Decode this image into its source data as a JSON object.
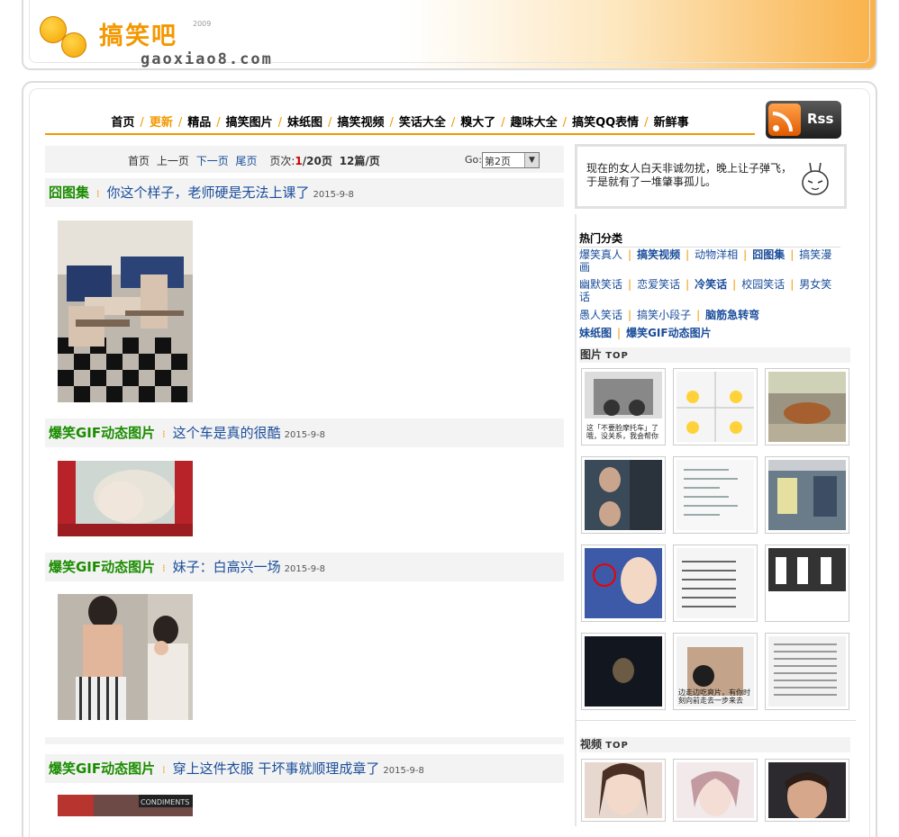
{
  "logo": {
    "cn": "搞笑吧",
    "year": "2009",
    "en": "gaoxiao8.com"
  },
  "nav": [
    {
      "label": "首页",
      "active": false
    },
    {
      "label": "更新",
      "active": true
    },
    {
      "label": "精品",
      "active": false
    },
    {
      "label": "搞笑图片",
      "active": false
    },
    {
      "label": "妹纸图",
      "active": false
    },
    {
      "label": "搞笑视频",
      "active": false
    },
    {
      "label": "笑话大全",
      "active": false
    },
    {
      "label": "糗大了",
      "active": false
    },
    {
      "label": "趣味大全",
      "active": false
    },
    {
      "label": "搞笑QQ表情",
      "active": false
    },
    {
      "label": "新鲜事",
      "active": false
    }
  ],
  "rss": {
    "label": "Rss"
  },
  "pager": {
    "first": "首页",
    "prev": "上一页",
    "next": "下一页",
    "last": "尾页",
    "pages_label": "页次:",
    "current": "1",
    "total": "/20页",
    "per_page": "12篇/页",
    "go_label": "Go:",
    "go_value": "第2页"
  },
  "posts": [
    {
      "category": "囧图集",
      "title": "你这个样子，老师硬是无法上课了",
      "date": "2015-9-8"
    },
    {
      "category": "爆笑GIF动态图片",
      "title": "这个车是真的很酷",
      "date": "2015-9-8"
    },
    {
      "category": "爆笑GIF动态图片",
      "title": "妹子：白高兴一场",
      "date": "2015-9-8"
    },
    {
      "category": "爆笑GIF动态图片",
      "title": "穿上这件衣服 干坏事就顺理成章了",
      "date": "2015-9-8"
    }
  ],
  "sidebar": {
    "quote": "现在的女人白天非诚勿扰，晚上让子弹飞，于是就有了一堆肇事孤儿。",
    "hot_title": "热门分类",
    "hot_rows": [
      [
        "爆笑真人",
        "搞笑视频",
        "动物洋相",
        "囧图集",
        "搞笑漫画"
      ],
      [
        "幽默笑话",
        "恋爱笑话",
        "冷笑话",
        "校园笑话",
        "男女笑话"
      ],
      [
        "愚人笑话",
        "搞笑小段子",
        "脑筋急转弯"
      ],
      [
        "妹纸图",
        "爆笑GIF动态图片"
      ]
    ],
    "pics_title": "图片",
    "pics_top": "TOP",
    "video_title": "视频",
    "video_top": "TOP",
    "pic_captions": [
      "这「不要脸摩托车」了 哦，没关系，我会帮你脸哈",
      "",
      "",
      "",
      "",
      "",
      "",
      "",
      "",
      "",
      "边走边吃爽片，有你时刻向前走去一步来去",
      ""
    ]
  },
  "colors": {
    "accent": "#f39800",
    "link": "#1a4d9a",
    "category": "#1b8c00"
  }
}
